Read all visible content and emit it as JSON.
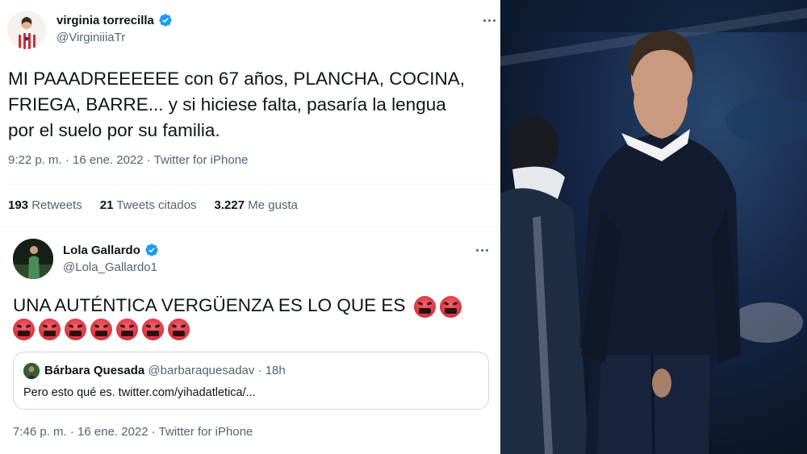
{
  "tweet1": {
    "name": "virginia torrecilla",
    "handle": "@VirginiiiaTr",
    "text_lines": [
      "MI PAAADREEEEEE con 67 años, PLANCHA, COCINA,",
      "FRIEGA, BARRE... y si hiciese falta, pasaría la lengua",
      "por el suelo por su familia."
    ],
    "meta": "9:22 p. m. · 16 ene. 2022 · Twitter for iPhone",
    "stats": [
      {
        "num": "193",
        "label": "Retweets"
      },
      {
        "num": "21",
        "label": "Tweets citados"
      },
      {
        "num": "3.227",
        "label": "Me gusta"
      }
    ]
  },
  "tweet2": {
    "name": "Lola Gallardo",
    "handle": "@Lola_Gallardo1",
    "text": "UNA AUTÉNTICA VERGÜENZA ES LO QUE ES",
    "emoji_inline_count": 2,
    "emoji_line2_count": 7,
    "quote": {
      "name": "Bárbara Quesada",
      "handle_time": "@barbaraquesadav · 18h",
      "text": "Pero esto qué es. twitter.com/yihadatletica/..."
    },
    "meta": "7:46 p. m. · 16 ene. 2022 · Twitter for iPhone"
  },
  "colors": {
    "verified": "#1d9bf0",
    "text": "#0f1419",
    "secondary": "#536471",
    "angry_emoji": "#d8323f"
  },
  "photo": {
    "subject": "man-in-navy-sweater-photo"
  }
}
